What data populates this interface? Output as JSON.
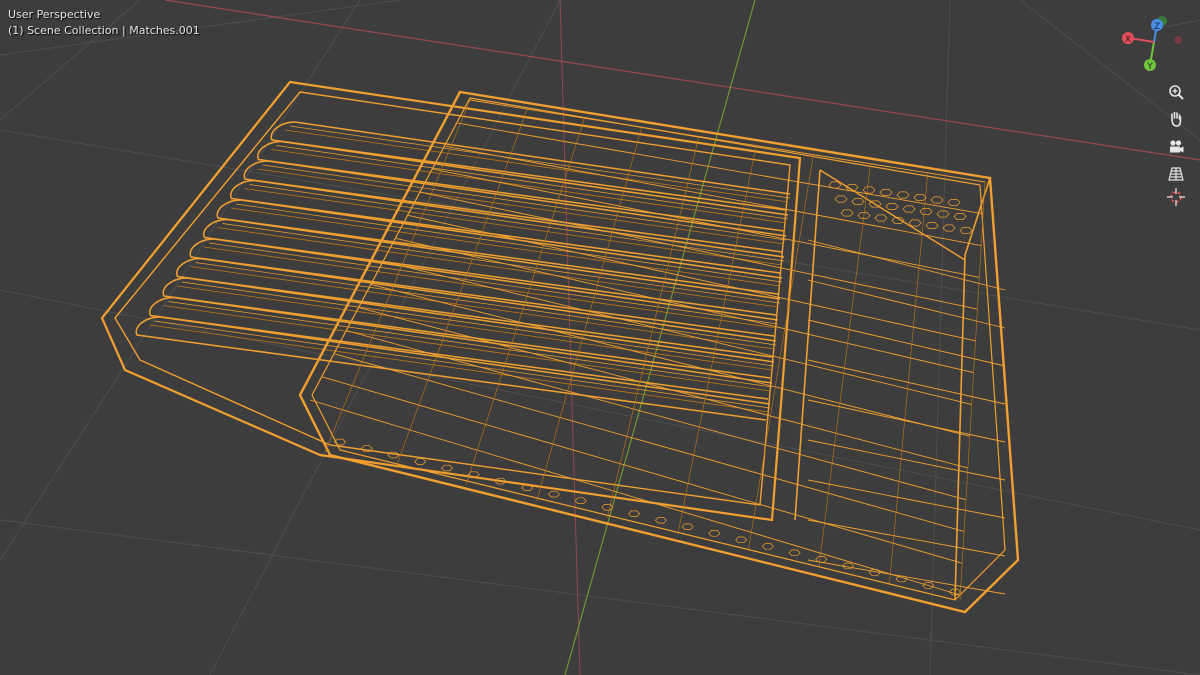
{
  "viewport": {
    "view_name": "User Perspective",
    "scene_info": "(1) Scene Collection | Matches.001"
  },
  "gizmo": {
    "x_label": "X",
    "y_label": "Y",
    "z_label": "Z"
  },
  "nav_tools": [
    {
      "name": "zoom-icon"
    },
    {
      "name": "pan-hand-icon"
    },
    {
      "name": "camera-view-icon"
    },
    {
      "name": "ortho-grid-icon"
    },
    {
      "name": "3d-cursor-icon"
    }
  ],
  "colors": {
    "background": "#3d3d3d",
    "grid": "#505050",
    "x_axis": "#9c4a4f",
    "y_axis": "#6e9633",
    "wire": "#f0a030",
    "wire_dark": "#c07818",
    "gizmo_x": "#e0505c",
    "gizmo_y": "#70c440",
    "gizmo_z": "#4a90e8"
  }
}
